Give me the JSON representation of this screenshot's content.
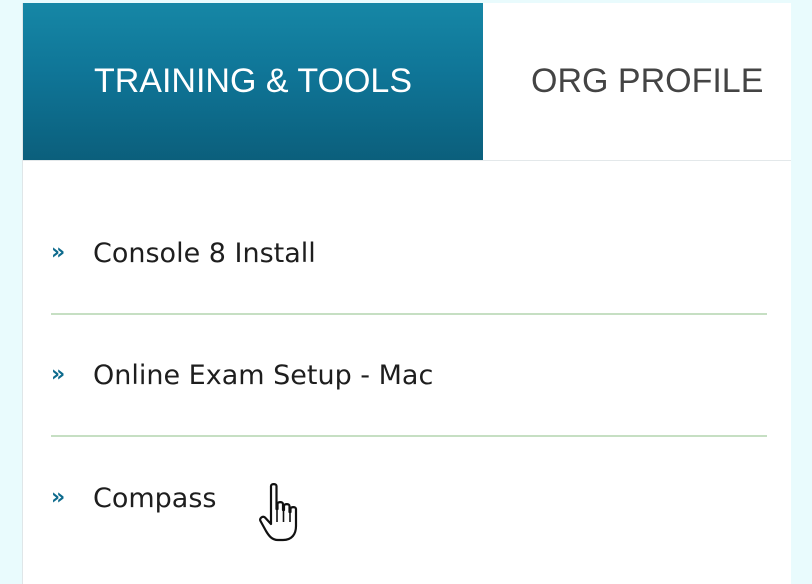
{
  "tabs": [
    {
      "label": "TRAINING & TOOLS",
      "active": true
    },
    {
      "label": "ORG PROFILE",
      "active": false
    }
  ],
  "links": [
    {
      "label": "Console 8 Install",
      "icon": "double-chevron-right-icon"
    },
    {
      "label": "Online Exam Setup - Mac",
      "icon": "double-chevron-right-icon"
    },
    {
      "label": "Compass",
      "icon": "double-chevron-right-icon"
    }
  ],
  "glyphs": {
    "chevron": "»"
  },
  "colors": {
    "accent": "#0f7597",
    "background": "#e9fbfd",
    "divider": "#c6dfc3"
  }
}
